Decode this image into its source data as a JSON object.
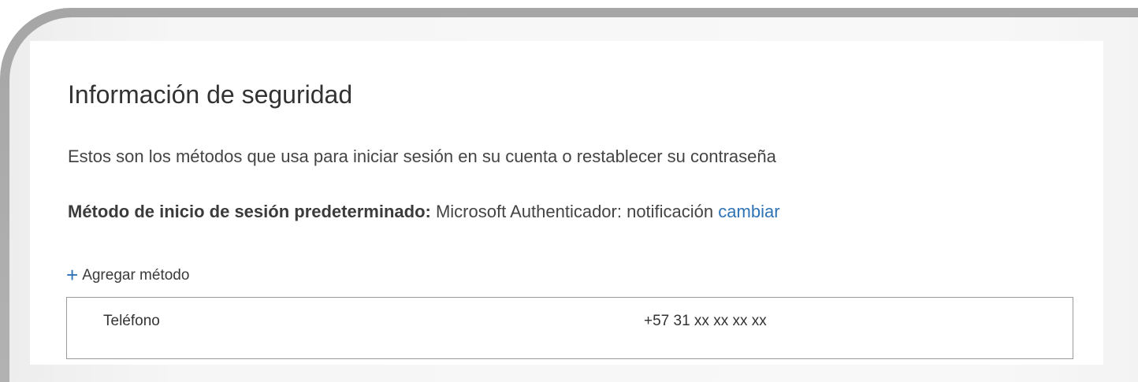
{
  "header": {
    "title": "Información de seguridad",
    "description": "Estos son los métodos que usa para iniciar sesión en su cuenta o restablecer su contraseña"
  },
  "default_method": {
    "label": "Método de inicio de sesión predeterminado:",
    "value": "Microsoft Authenticador: notificación",
    "change_link": "cambiar"
  },
  "add_method": {
    "icon": "plus-icon",
    "icon_glyph": "+",
    "label": "Agregar método"
  },
  "methods": [
    {
      "name": "Teléfono",
      "value": "+57 31 xx xx xx xx"
    }
  ],
  "colors": {
    "accent": "#2f73b4",
    "text": "#333333",
    "border": "#9a9a9a",
    "frame": "#a8a8a8"
  }
}
